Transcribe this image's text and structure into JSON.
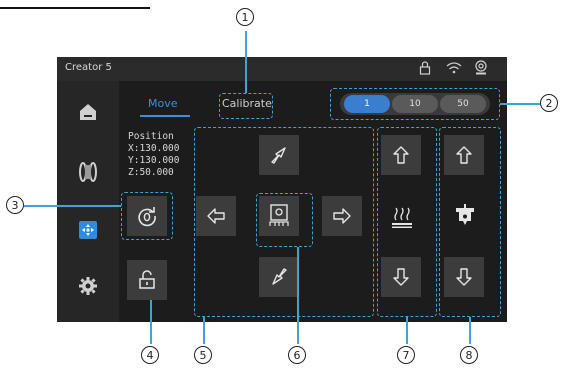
{
  "app": {
    "title": "Creator 5"
  },
  "status_icons": [
    "lock-icon",
    "wifi-icon",
    "camera-icon"
  ],
  "sidebar": {
    "items": [
      {
        "name": "home",
        "icon": "home-icon"
      },
      {
        "name": "filament",
        "icon": "filament-spool-icon"
      },
      {
        "name": "control",
        "icon": "control-icon",
        "active": true
      },
      {
        "name": "settings",
        "icon": "gear-icon"
      }
    ]
  },
  "tabs": [
    {
      "label": "Move",
      "active": true
    },
    {
      "label": "Calibrate",
      "active": false
    }
  ],
  "speed": {
    "options": [
      "1",
      "10",
      "50"
    ],
    "selected": "1"
  },
  "position": {
    "label": "Position",
    "x": "X:130.000",
    "y": "Y:130.000",
    "z": "Z:50.000"
  },
  "callouts": [
    "1",
    "2",
    "3",
    "4",
    "5",
    "6",
    "7",
    "8"
  ],
  "colors": {
    "accent": "#3b8fe3",
    "dash": "#3ea4d8",
    "tile": "#3c3c3c",
    "screen": "#1c1c1c"
  }
}
